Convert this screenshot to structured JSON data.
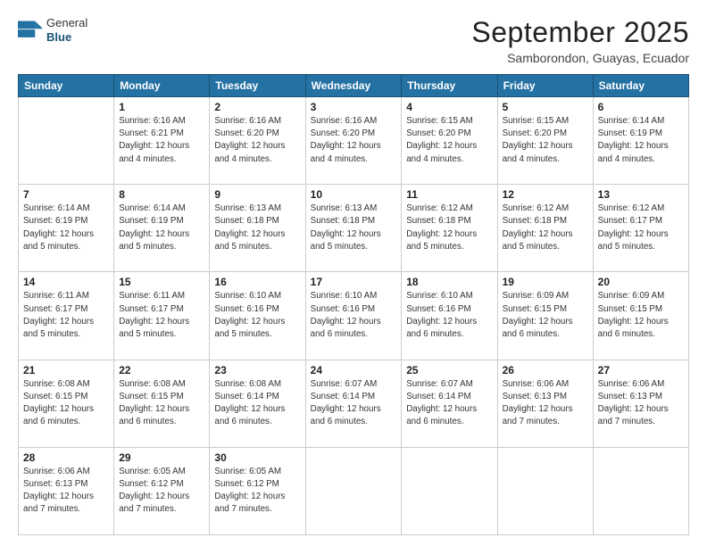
{
  "header": {
    "logo_line1": "General",
    "logo_line2": "Blue",
    "month": "September 2025",
    "location": "Samborondon, Guayas, Ecuador"
  },
  "weekdays": [
    "Sunday",
    "Monday",
    "Tuesday",
    "Wednesday",
    "Thursday",
    "Friday",
    "Saturday"
  ],
  "weeks": [
    [
      {
        "day": "",
        "info": ""
      },
      {
        "day": "1",
        "info": "Sunrise: 6:16 AM\nSunset: 6:21 PM\nDaylight: 12 hours\nand 4 minutes."
      },
      {
        "day": "2",
        "info": "Sunrise: 6:16 AM\nSunset: 6:20 PM\nDaylight: 12 hours\nand 4 minutes."
      },
      {
        "day": "3",
        "info": "Sunrise: 6:16 AM\nSunset: 6:20 PM\nDaylight: 12 hours\nand 4 minutes."
      },
      {
        "day": "4",
        "info": "Sunrise: 6:15 AM\nSunset: 6:20 PM\nDaylight: 12 hours\nand 4 minutes."
      },
      {
        "day": "5",
        "info": "Sunrise: 6:15 AM\nSunset: 6:20 PM\nDaylight: 12 hours\nand 4 minutes."
      },
      {
        "day": "6",
        "info": "Sunrise: 6:14 AM\nSunset: 6:19 PM\nDaylight: 12 hours\nand 4 minutes."
      }
    ],
    [
      {
        "day": "7",
        "info": "Sunrise: 6:14 AM\nSunset: 6:19 PM\nDaylight: 12 hours\nand 5 minutes."
      },
      {
        "day": "8",
        "info": "Sunrise: 6:14 AM\nSunset: 6:19 PM\nDaylight: 12 hours\nand 5 minutes."
      },
      {
        "day": "9",
        "info": "Sunrise: 6:13 AM\nSunset: 6:18 PM\nDaylight: 12 hours\nand 5 minutes."
      },
      {
        "day": "10",
        "info": "Sunrise: 6:13 AM\nSunset: 6:18 PM\nDaylight: 12 hours\nand 5 minutes."
      },
      {
        "day": "11",
        "info": "Sunrise: 6:12 AM\nSunset: 6:18 PM\nDaylight: 12 hours\nand 5 minutes."
      },
      {
        "day": "12",
        "info": "Sunrise: 6:12 AM\nSunset: 6:18 PM\nDaylight: 12 hours\nand 5 minutes."
      },
      {
        "day": "13",
        "info": "Sunrise: 6:12 AM\nSunset: 6:17 PM\nDaylight: 12 hours\nand 5 minutes."
      }
    ],
    [
      {
        "day": "14",
        "info": "Sunrise: 6:11 AM\nSunset: 6:17 PM\nDaylight: 12 hours\nand 5 minutes."
      },
      {
        "day": "15",
        "info": "Sunrise: 6:11 AM\nSunset: 6:17 PM\nDaylight: 12 hours\nand 5 minutes."
      },
      {
        "day": "16",
        "info": "Sunrise: 6:10 AM\nSunset: 6:16 PM\nDaylight: 12 hours\nand 5 minutes."
      },
      {
        "day": "17",
        "info": "Sunrise: 6:10 AM\nSunset: 6:16 PM\nDaylight: 12 hours\nand 6 minutes."
      },
      {
        "day": "18",
        "info": "Sunrise: 6:10 AM\nSunset: 6:16 PM\nDaylight: 12 hours\nand 6 minutes."
      },
      {
        "day": "19",
        "info": "Sunrise: 6:09 AM\nSunset: 6:15 PM\nDaylight: 12 hours\nand 6 minutes."
      },
      {
        "day": "20",
        "info": "Sunrise: 6:09 AM\nSunset: 6:15 PM\nDaylight: 12 hours\nand 6 minutes."
      }
    ],
    [
      {
        "day": "21",
        "info": "Sunrise: 6:08 AM\nSunset: 6:15 PM\nDaylight: 12 hours\nand 6 minutes."
      },
      {
        "day": "22",
        "info": "Sunrise: 6:08 AM\nSunset: 6:15 PM\nDaylight: 12 hours\nand 6 minutes."
      },
      {
        "day": "23",
        "info": "Sunrise: 6:08 AM\nSunset: 6:14 PM\nDaylight: 12 hours\nand 6 minutes."
      },
      {
        "day": "24",
        "info": "Sunrise: 6:07 AM\nSunset: 6:14 PM\nDaylight: 12 hours\nand 6 minutes."
      },
      {
        "day": "25",
        "info": "Sunrise: 6:07 AM\nSunset: 6:14 PM\nDaylight: 12 hours\nand 6 minutes."
      },
      {
        "day": "26",
        "info": "Sunrise: 6:06 AM\nSunset: 6:13 PM\nDaylight: 12 hours\nand 7 minutes."
      },
      {
        "day": "27",
        "info": "Sunrise: 6:06 AM\nSunset: 6:13 PM\nDaylight: 12 hours\nand 7 minutes."
      }
    ],
    [
      {
        "day": "28",
        "info": "Sunrise: 6:06 AM\nSunset: 6:13 PM\nDaylight: 12 hours\nand 7 minutes."
      },
      {
        "day": "29",
        "info": "Sunrise: 6:05 AM\nSunset: 6:12 PM\nDaylight: 12 hours\nand 7 minutes."
      },
      {
        "day": "30",
        "info": "Sunrise: 6:05 AM\nSunset: 6:12 PM\nDaylight: 12 hours\nand 7 minutes."
      },
      {
        "day": "",
        "info": ""
      },
      {
        "day": "",
        "info": ""
      },
      {
        "day": "",
        "info": ""
      },
      {
        "day": "",
        "info": ""
      }
    ]
  ]
}
